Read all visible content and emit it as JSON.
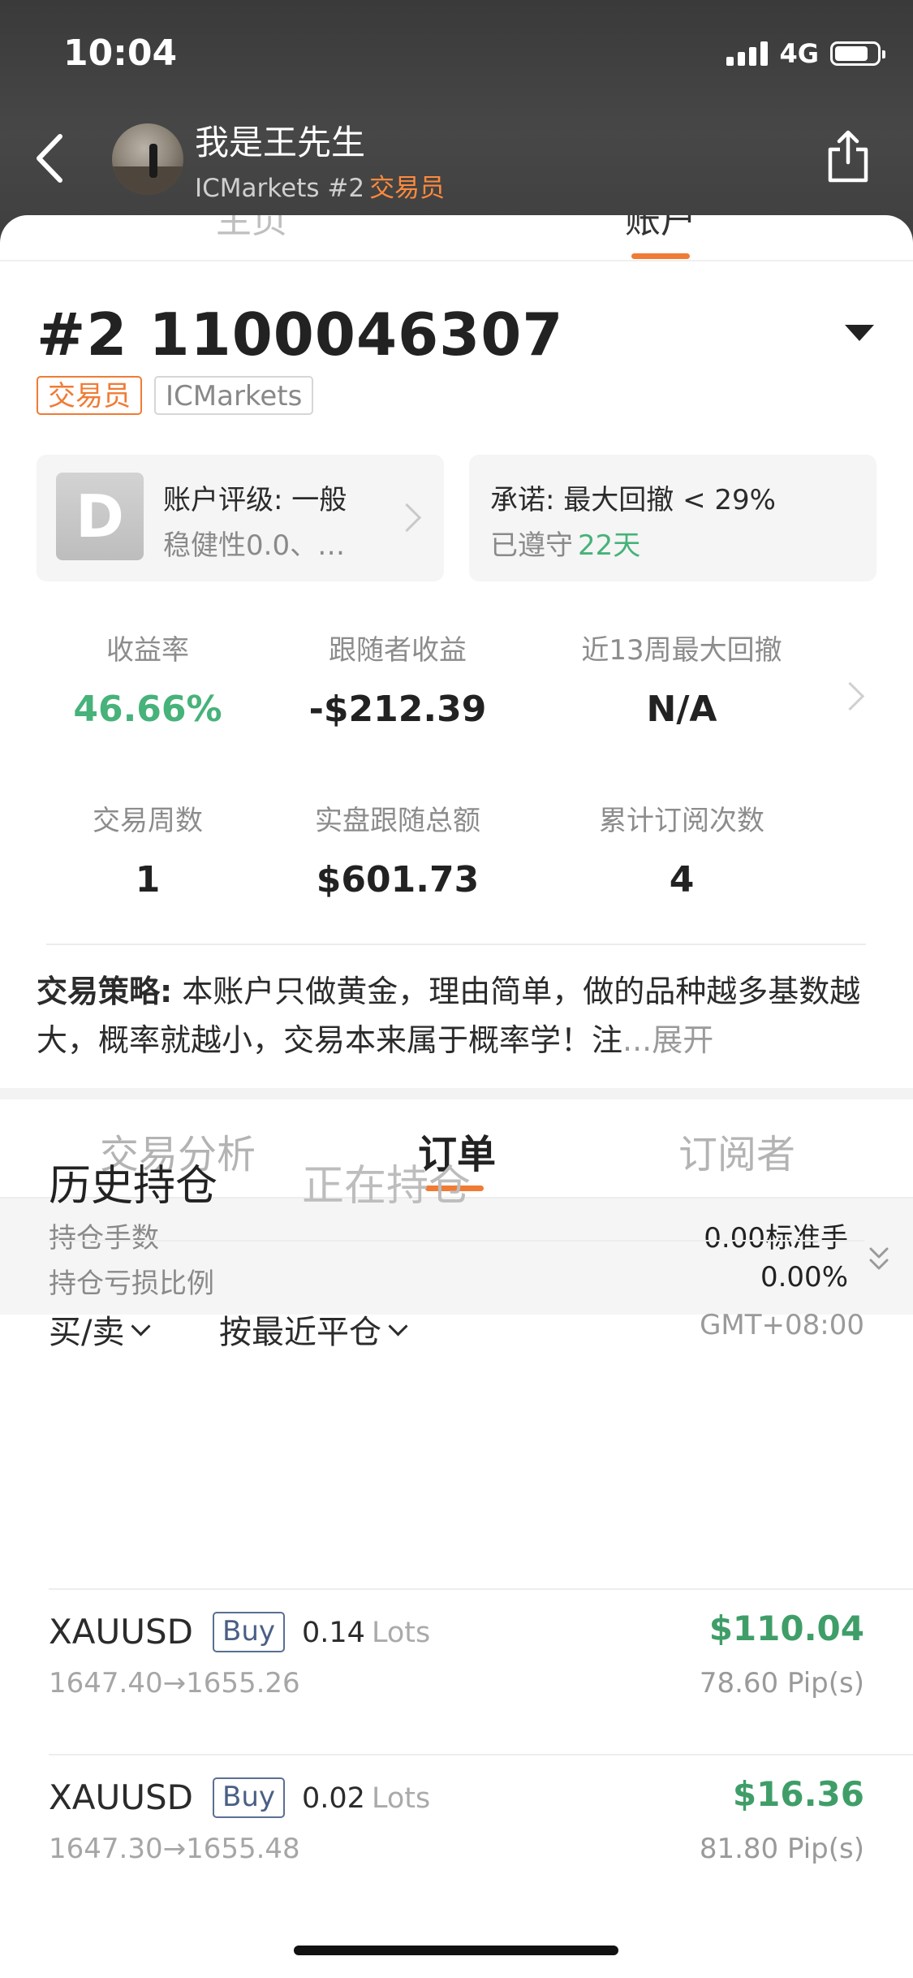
{
  "status_bar": {
    "time": "10:04",
    "network": "4G",
    "battery_level": 0.8
  },
  "profile": {
    "name": "我是王先生",
    "broker": "ICMarkets #2",
    "role": "交易员"
  },
  "sheet_tabs": [
    "主页",
    "账户"
  ],
  "account": {
    "title": "#2 1100046307",
    "tag_role": "交易员",
    "tag_broker": "ICMarkets"
  },
  "rating_card": {
    "grade": "D",
    "line1": "账户评级: 一般",
    "line2": "稳健性0.0、…"
  },
  "promise_card": {
    "line1": "承诺: 最大回撤 < 29%",
    "line2": "已遵守",
    "days": "22天"
  },
  "stats": [
    {
      "label": "收益率",
      "value": "46.66%"
    },
    {
      "label": "跟随者收益",
      "value": "-$212.39"
    },
    {
      "label": "近13周最大回撤",
      "value": "N/A"
    },
    {
      "label": "交易周数",
      "value": "1"
    },
    {
      "label": "实盘跟随总额",
      "value": "$601.73"
    },
    {
      "label": "累计订阅次数",
      "value": "4"
    }
  ],
  "strategy": {
    "label": "交易策略:",
    "text": " 本账户只做黄金，理由简单，做的品种越多基数越大，概率就越小，交易本来属于概率学！注",
    "ellipsis": "...",
    "more": "展开"
  },
  "sub_tabs": [
    "交易分析",
    "订单",
    "订阅者"
  ],
  "position_summary": {
    "lots_label": "持仓手数",
    "lots_value": "0.00标准手",
    "pl_label": "持仓亏损比例",
    "pl_value": "0.00%"
  },
  "history_tabs": [
    "历史持仓",
    "正在持仓"
  ],
  "filters": {
    "side": "买/卖",
    "sort": "按最近平仓",
    "timezone": "GMT+08:00"
  },
  "orders": [
    {
      "symbol": "XAUUSD",
      "side": "Buy",
      "lots": "0.14",
      "lots_unit": "Lots",
      "price": "1647.40→1655.26",
      "profit": "$110.04",
      "pips": "78.60 Pip(s)"
    },
    {
      "symbol": "XAUUSD",
      "side": "Buy",
      "lots": "0.02",
      "lots_unit": "Lots",
      "price": "1647.30→1655.48",
      "profit": "$16.36",
      "pips": "81.80 Pip(s)"
    }
  ],
  "colors": {
    "accent": "#f07b34",
    "positive": "#3f9e68",
    "promise_days": "#47b27a"
  }
}
